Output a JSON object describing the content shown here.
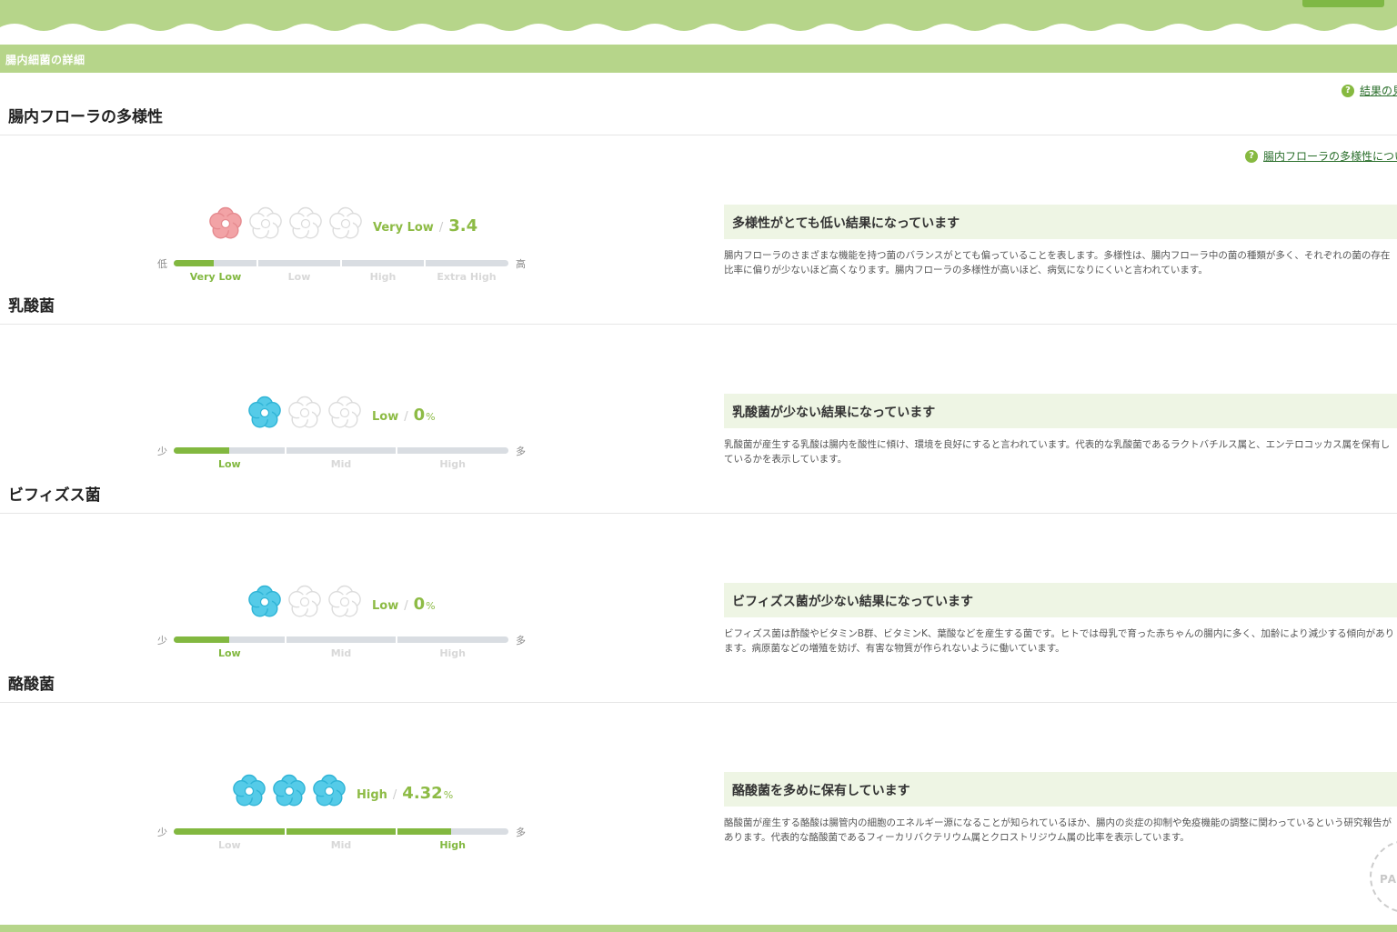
{
  "colors": {
    "accent": "#82b840",
    "header": "#b6d58a",
    "flower_pink": "#f2a3a6",
    "flower_blue": "#55cbe8",
    "track": "#d9dde2"
  },
  "header": {
    "section_title": "腸内細菌の詳細"
  },
  "links": {
    "result_view": "結果の見",
    "diversity_about": "腸内フローラの多様性につい"
  },
  "badge_text": "PAG",
  "sections": [
    {
      "title": "腸内フローラの多様性",
      "level": "Very Low",
      "value": "3.4",
      "unit": "",
      "flowers_active": 1,
      "flowers_total": 4,
      "flower_color": "pink",
      "scale_low": "低",
      "scale_high": "高",
      "segments": [
        "Very Low",
        "Low",
        "High",
        "Extra High"
      ],
      "active_segment": 0,
      "fill_fraction": 0.12,
      "heading": "多様性がとても低い結果になっています",
      "description": "腸内フローラのさまざまな機能を持つ菌のバランスがとても偏っていることを表します。多様性は、腸内フローラ中の菌の種類が多く、それぞれの菌の存在比率に偏りが少ないほど高くなります。腸内フローラの多様性が高いほど、病気になりにくいと言われています。"
    },
    {
      "title": "乳酸菌",
      "level": "Low",
      "value": "0",
      "unit": "%",
      "flowers_active": 1,
      "flowers_total": 3,
      "flower_color": "blue",
      "scale_low": "少",
      "scale_high": "多",
      "segments": [
        "Low",
        "Mid",
        "High"
      ],
      "active_segment": 0,
      "fill_fraction": 0.165,
      "heading": "乳酸菌が少ない結果になっています",
      "description": "乳酸菌が産生する乳酸は腸内を酸性に傾け、環境を良好にすると言われています。代表的な乳酸菌であるラクトバチルス属と、エンテロコッカス属を保有しているかを表示しています。"
    },
    {
      "title": "ビフィズス菌",
      "level": "Low",
      "value": "0",
      "unit": "%",
      "flowers_active": 1,
      "flowers_total": 3,
      "flower_color": "blue",
      "scale_low": "少",
      "scale_high": "多",
      "segments": [
        "Low",
        "Mid",
        "High"
      ],
      "active_segment": 0,
      "fill_fraction": 0.165,
      "heading": "ビフィズス菌が少ない結果になっています",
      "description": "ビフィズス菌は酢酸やビタミンB群、ビタミンK、葉酸などを産生する菌です。ヒトでは母乳で育った赤ちゃんの腸内に多く、加齢により減少する傾向があります。病原菌などの増殖を妨げ、有害な物質が作られないように働いています。"
    },
    {
      "title": "酪酸菌",
      "level": "High",
      "value": "4.32",
      "unit": "%",
      "flowers_active": 3,
      "flowers_total": 3,
      "flower_color": "blue",
      "scale_low": "少",
      "scale_high": "多",
      "segments": [
        "Low",
        "Mid",
        "High"
      ],
      "active_segment": 2,
      "fill_fraction": 0.83,
      "heading": "酪酸菌を多めに保有しています",
      "description": "酪酸菌が産生する酪酸は腸管内の細胞のエネルギー源になることが知られているほか、腸内の炎症の抑制や免疫機能の調整に関わっているという研究報告があります。代表的な酪酸菌であるフィーカリバクテリウム属とクロストリジウム属の比率を表示しています。"
    }
  ]
}
